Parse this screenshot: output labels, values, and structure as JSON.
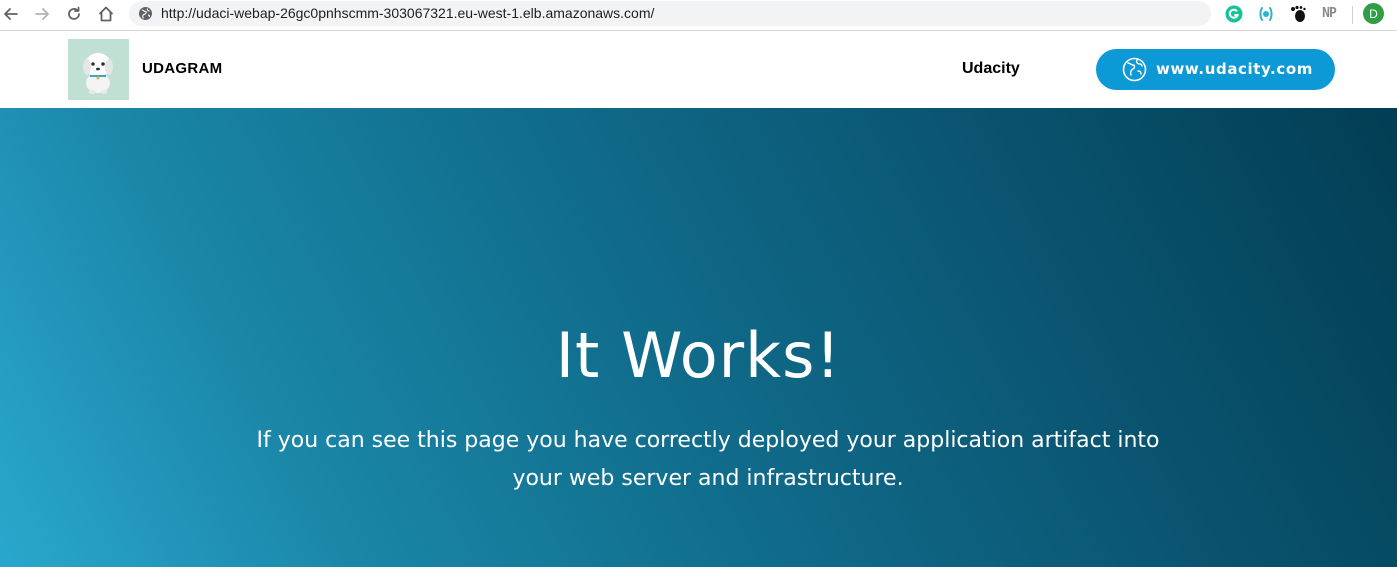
{
  "browser": {
    "url": "http://udaci-webap-26gc0pnhscmm-303067321.eu-west-1.elb.amazonaws.com/",
    "extensions": [
      {
        "name": "grammarly-icon"
      },
      {
        "name": "extension-icon"
      },
      {
        "name": "gnome-icon"
      },
      {
        "name": "np-icon",
        "label": "NP"
      }
    ],
    "profile_initial": "D"
  },
  "header": {
    "brand": "UDAGRAM",
    "nav_link": "Udacity",
    "cta_label": "www.udacity.com"
  },
  "hero": {
    "title": "It Works!",
    "text": "If you can see this page you have correctly deployed your application artifact into your web server and infrastructure."
  },
  "colors": {
    "accent": "#0d98d6",
    "hero_gradient_start": "#2aa7cd",
    "hero_gradient_end": "#023e54",
    "logo_bg": "#bfe0d2"
  }
}
